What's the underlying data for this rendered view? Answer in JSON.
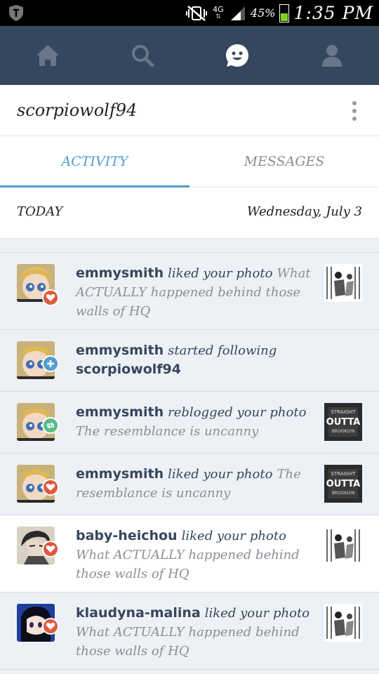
{
  "status_bar": {
    "network": "4G",
    "battery_percent": "45%",
    "time": "1:35 PM"
  },
  "nav": {
    "items": [
      {
        "name": "home",
        "icon": "home-icon"
      },
      {
        "name": "search",
        "icon": "search-icon"
      },
      {
        "name": "activity",
        "icon": "smiley-icon"
      },
      {
        "name": "account",
        "icon": "user-icon"
      }
    ]
  },
  "header": {
    "blog_name": "scorpiowolf94"
  },
  "tabs": {
    "activity": "ACTIVITY",
    "messages": "MESSAGES"
  },
  "date_bar": {
    "label": "TODAY",
    "date": "Wednesday, July 3"
  },
  "feed": [
    {
      "user": "emmysmith",
      "action": "liked your photo",
      "excerpt": "What ACTUALLY happened behind those walls of HQ",
      "badge": "heart-icon",
      "thumb": "comic-thumb"
    },
    {
      "user": "emmysmith",
      "action": "started following",
      "target": "scorpiowolf94",
      "badge": "plus-icon",
      "thumb": ""
    },
    {
      "user": "emmysmith",
      "action": "reblogged your photo",
      "excerpt": "The resemblance is uncanny",
      "badge": "reblog-icon",
      "thumb": "poster-thumb"
    },
    {
      "user": "emmysmith",
      "action": "liked your photo",
      "excerpt": "The resemblance is uncanny",
      "badge": "heart-icon",
      "thumb": "poster-thumb"
    },
    {
      "user": "baby-heichou",
      "action": "liked your photo",
      "excerpt": "What ACTUALLY happened behind those walls of HQ",
      "badge": "heart-icon",
      "thumb": "comic-thumb"
    },
    {
      "user": "klaudyna-malina",
      "action": "liked your photo",
      "excerpt": "What ACTUALLY happened behind those walls of HQ",
      "badge": "heart-icon",
      "thumb": "comic-thumb"
    }
  ],
  "poster_text": {
    "line1": "STRAIGHT",
    "line2": "OUTTA",
    "line3": "BROOKLYN"
  },
  "colors": {
    "nav_bg": "#36465d",
    "accent": "#529ecc",
    "heart": "#e0583d",
    "reblog": "#56bc8a"
  }
}
